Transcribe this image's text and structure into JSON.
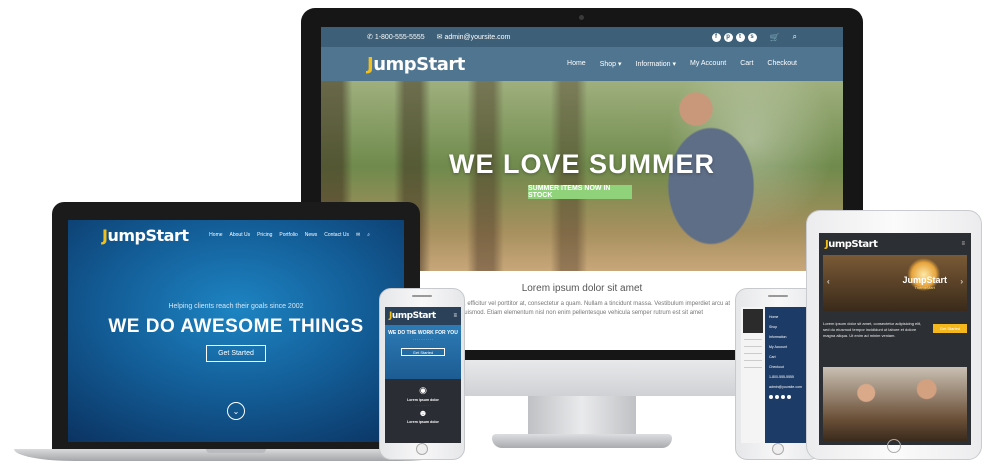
{
  "brand": {
    "name_j": "J",
    "name_rest": "umpStart"
  },
  "desktop": {
    "topbar": {
      "phone": "1-800-555-5555",
      "email": "admin@yoursite.com"
    },
    "menu": [
      "Home",
      "Shop ▾",
      "Information ▾",
      "My Account",
      "Cart",
      "Checkout"
    ],
    "hero_title": "WE LOVE SUMMER",
    "hero_button": "SUMMER ITEMS NOW IN STOCK",
    "section_title": "Lorem ipsum dolor sit amet",
    "section_text": "massa velit, efficitur vel porttitor at, consectetur a quam. Nullam a tincidunt massa. Vestibulum imperdiet arcu at euismod. Etiam elementum nisl non enim pellentesque vehicula semper rutrum est sit amet"
  },
  "laptop": {
    "menu": [
      "Home",
      "About Us",
      "Pricing",
      "Portfolio",
      "News",
      "Contact Us"
    ],
    "tagline": "Helping clients reach their goals since 2002",
    "title": "WE DO AWESOME THINGS",
    "button": "Get Started"
  },
  "phone_left": {
    "hero_title": "WE DO THE WORK FOR YOU",
    "button": "Get Started",
    "item_title": "Lorem ipsum dolor"
  },
  "phone_right": {
    "menu": [
      "Home",
      "Shop",
      "Information",
      "My Account",
      "Cart",
      "Checkout"
    ],
    "phone": "1-800-555-5555",
    "email": "admin@yoursite.com"
  },
  "tablet": {
    "slide_title": "JumpStart",
    "slide_sub": "ThemeMart",
    "text": "Lorem ipsum dolor sit amet, consectetur adipisicing elit, sed do eiusmod tempor incididunt ut labore et dolore magna aliqua. Ut enim ad minim veniam.",
    "button": "Get Started"
  },
  "colors": {
    "accent_yellow": "#f2c01c",
    "nav_blue": "#4f7590",
    "cta_green": "#8fd27a",
    "laptop_blue": "#135d97"
  }
}
